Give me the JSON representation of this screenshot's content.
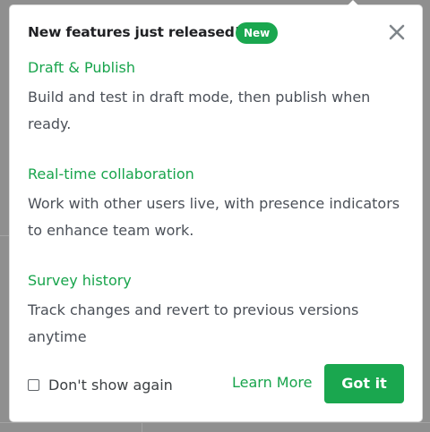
{
  "colors": {
    "accent": "#1aa74f",
    "link": "#18a44c",
    "title_text": "#202124",
    "body_text": "#4b5058"
  },
  "popover": {
    "title": "New features just released!",
    "badge": "New",
    "close_icon": "close-icon",
    "features": [
      {
        "title": "Draft & Publish",
        "description": "Build and test in draft mode, then publish when ready."
      },
      {
        "title": "Real-time collaboration",
        "description": "Work with other users live, with presence indicators to enhance team work."
      },
      {
        "title": "Survey history",
        "description": "Track changes and revert to previous versions anytime"
      }
    ],
    "footer": {
      "dont_show_label": "Don't show again",
      "dont_show_checked": false,
      "learn_more_label": "Learn More",
      "got_it_label": "Got it"
    }
  }
}
